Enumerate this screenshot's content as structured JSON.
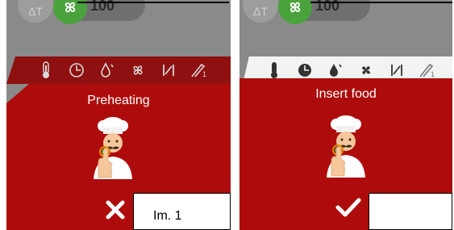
{
  "left_panel": {
    "top_temp_value": "100",
    "status_text": "Preheating",
    "action": "cancel",
    "caption": "Im. 1",
    "icons": [
      "thermometer-icon",
      "clock-icon",
      "humidity-icon",
      "fan-icon",
      "cycle-icon",
      "probe-icon"
    ]
  },
  "right_panel": {
    "top_temp_value": "100",
    "status_text": "Insert food",
    "action": "confirm",
    "icons": [
      "thermometer-icon",
      "clock-icon",
      "humidity-icon",
      "fan-icon",
      "cycle-icon",
      "probe-icon"
    ]
  },
  "colors": {
    "accent_red": "#ae0c0c",
    "dark_red": "#8f1010",
    "green": "#4aa23c",
    "gray": "#8a8a8a"
  }
}
